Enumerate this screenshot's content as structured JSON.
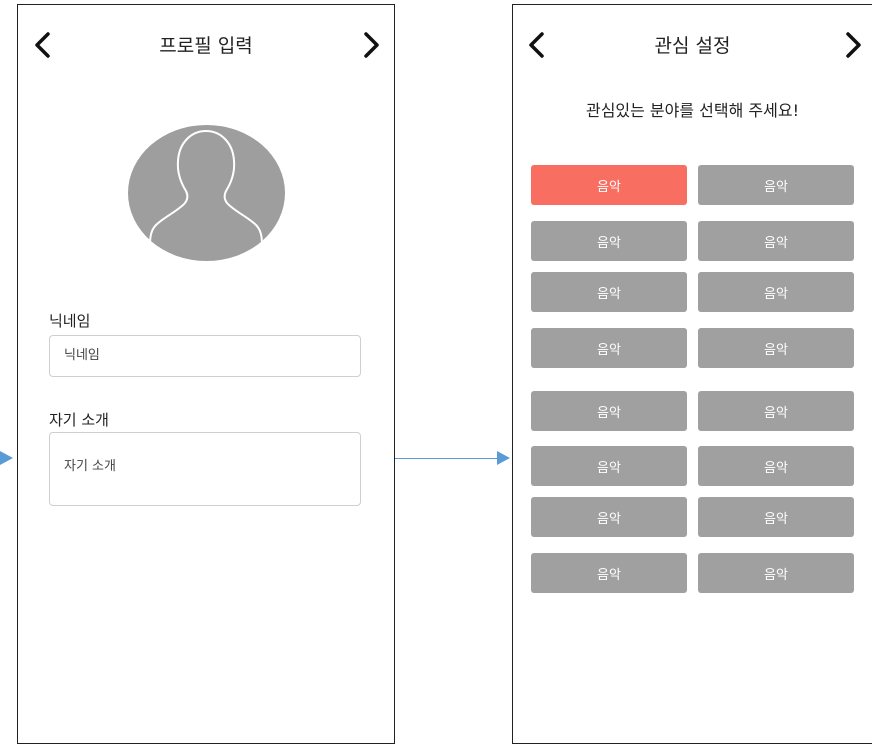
{
  "profile_screen": {
    "title": "프로필 입력",
    "back_icon": "chevron-left-icon",
    "next_icon": "chevron-right-icon",
    "avatar_icon": "user-silhouette-icon",
    "nickname_label": "닉네임",
    "nickname_placeholder": "닉네임",
    "intro_label": "자기 소개",
    "intro_placeholder": "자기 소개"
  },
  "interest_screen": {
    "title": "관심 설정",
    "subtitle": "관심있는 분야를 선택해 주세요!",
    "chips": [
      {
        "label": "음악",
        "selected": true
      },
      {
        "label": "음악",
        "selected": false
      },
      {
        "label": "음악",
        "selected": false
      },
      {
        "label": "음악",
        "selected": false
      },
      {
        "label": "음악",
        "selected": false
      },
      {
        "label": "음악",
        "selected": false
      },
      {
        "label": "음악",
        "selected": false
      },
      {
        "label": "음악",
        "selected": false
      },
      {
        "label": "음악",
        "selected": false
      },
      {
        "label": "음악",
        "selected": false
      },
      {
        "label": "음악",
        "selected": false
      },
      {
        "label": "음악",
        "selected": false
      },
      {
        "label": "음악",
        "selected": false
      },
      {
        "label": "음악",
        "selected": false
      },
      {
        "label": "음악",
        "selected": false
      },
      {
        "label": "음악",
        "selected": false
      }
    ]
  },
  "colors": {
    "chip_default": "#a0a0a0",
    "chip_selected": "#f86f62",
    "flow_arrow": "#5b9bd5",
    "avatar_bg": "#9e9e9e"
  }
}
